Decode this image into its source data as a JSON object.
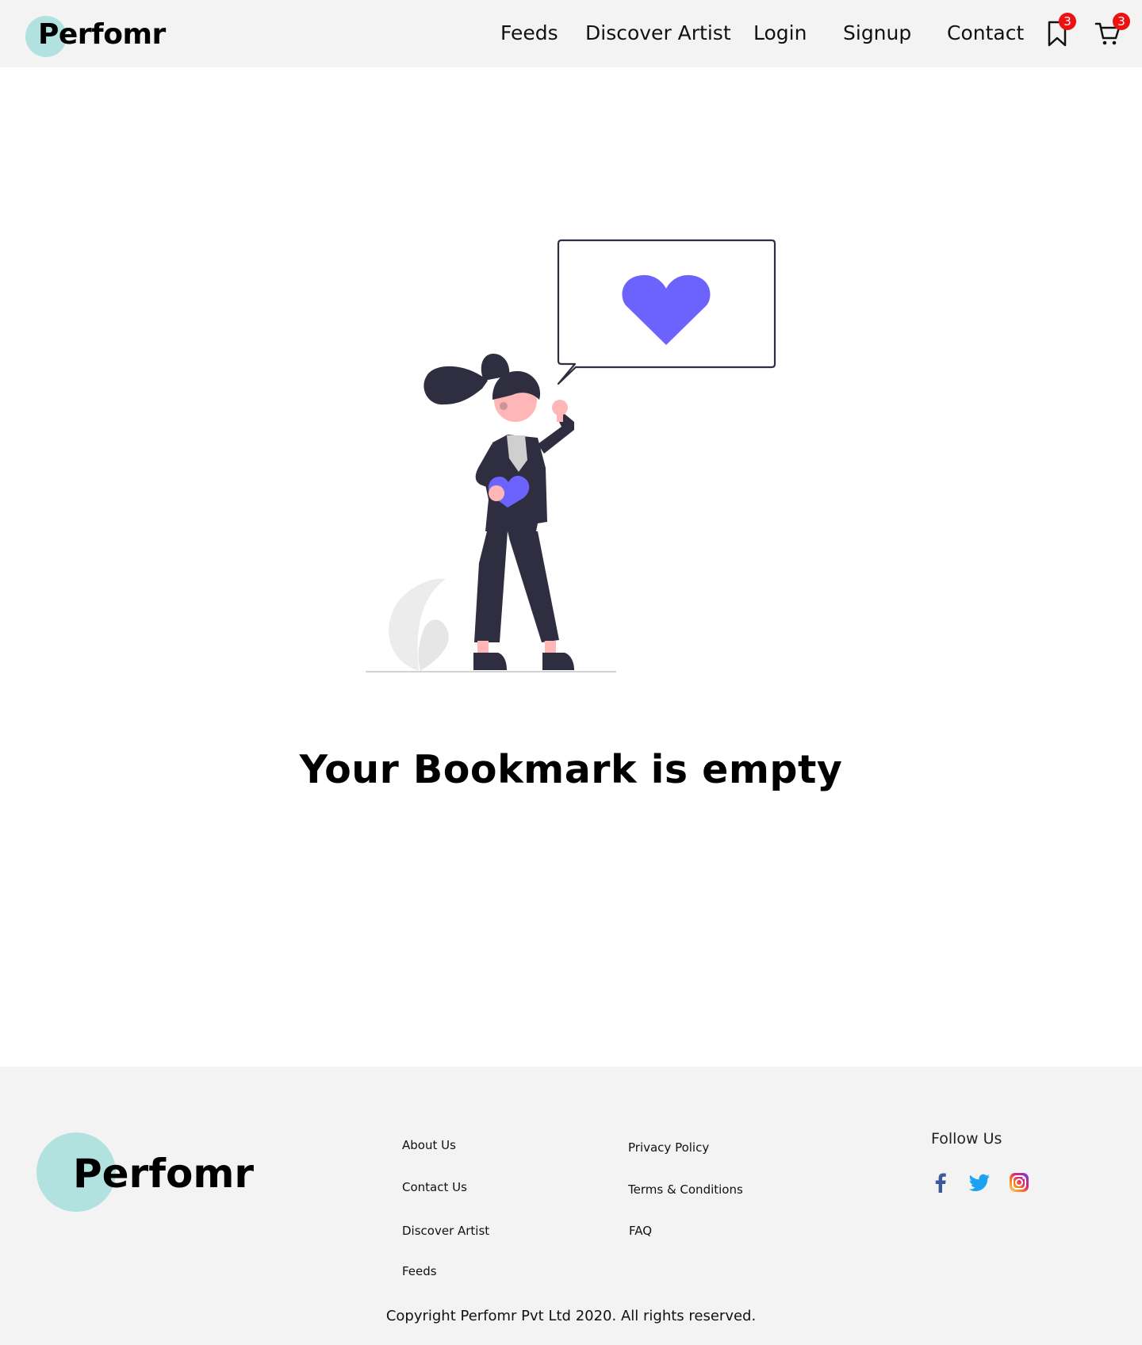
{
  "header": {
    "brand": "Perfomr",
    "nav": {
      "feeds": "Feeds",
      "discover": "Discover Artist",
      "login": "Login",
      "signup": "Signup",
      "contact": "Contact"
    },
    "bookmark_count": "3",
    "cart_count": "3"
  },
  "main": {
    "empty_message": "Your Bookmark is empty"
  },
  "footer": {
    "brand": "Perfomr",
    "links_col1": {
      "about": "About Us",
      "contact": "Contact Us",
      "discover": "Discover Artist",
      "feeds": "Feeds"
    },
    "links_col2": {
      "privacy": "Privacy Policy",
      "terms": "Terms & Conditions",
      "faq": "FAQ"
    },
    "follow_title": "Follow Us",
    "social": [
      "facebook-icon",
      "twitter-icon",
      "instagram-icon"
    ],
    "copyright": "Copyright Perfomr Pvt Ltd 2020. All rights reserved."
  },
  "colors": {
    "brand_circle": "#b2e2df",
    "accent_purple": "#6c63ff",
    "badge_red": "#ee1111",
    "band_gray": "#f3f3f3",
    "figure_dark": "#2f2e41",
    "skin": "#ffb6b6"
  }
}
